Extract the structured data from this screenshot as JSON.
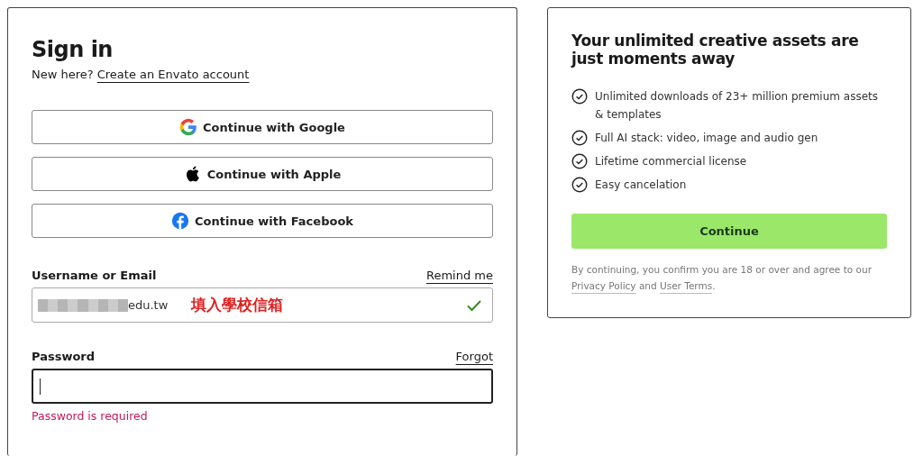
{
  "sign_in": {
    "title": "Sign in",
    "prompt": "New here?",
    "create_link": "Create an Envato account",
    "providers": [
      {
        "kind": "google",
        "label": "Continue with Google"
      },
      {
        "kind": "apple",
        "label": "Continue with Apple"
      },
      {
        "kind": "facebook",
        "label": "Continue with Facebook"
      }
    ],
    "fields": [
      {
        "label": "Username or Email",
        "link": "Remind me",
        "value": "edu.tw",
        "blurred_prefix": true,
        "valid": true,
        "focused": false,
        "annotation": "填入學校信箱"
      },
      {
        "label": "Password",
        "link": "Forgot",
        "blurred_prefix": false,
        "valid": false,
        "focused": true,
        "error": "Password is required"
      }
    ]
  },
  "promo": {
    "title": "Your unlimited creative assets are just moments away",
    "benefits": [
      "Unlimited downloads of 23+ million premium assets & templates",
      "Full AI stack: video, image and audio gen",
      "Lifetime commercial license",
      "Easy cancelation"
    ],
    "button": "Continue",
    "legal": [
      {
        "text": "By continuing, you confirm you are 18 or over and agree to our "
      },
      {
        "link": "Privacy Policy"
      },
      {
        "text": " and "
      },
      {
        "link": "User Terms"
      },
      {
        "text": "."
      }
    ]
  }
}
